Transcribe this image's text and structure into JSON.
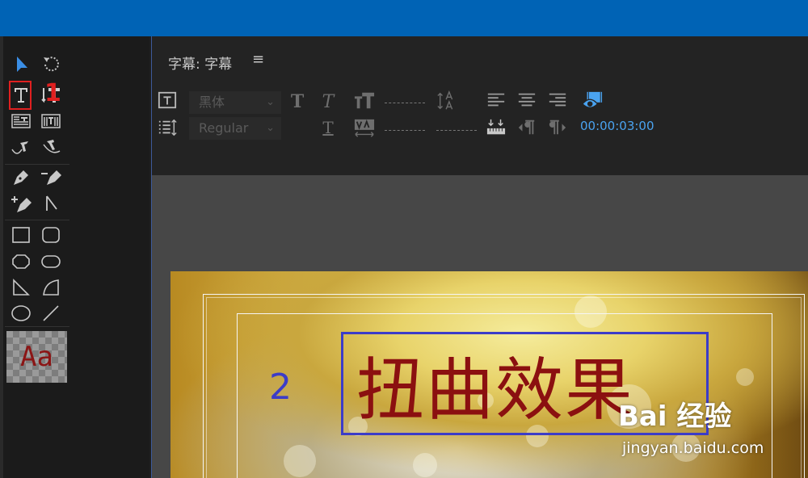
{
  "panel": {
    "title": "字幕: 字幕",
    "menu_icon": "hamburger-icon"
  },
  "toolbar": {
    "font_family": "黑体",
    "font_style": "Regular",
    "timecode": "00:00:03:00"
  },
  "tools": [
    "selection-tool",
    "rotation-tool",
    "type-tool",
    "vertical-type-tool",
    "area-type-tool",
    "vertical-area-type-tool",
    "path-type-tool",
    "vertical-path-type-tool",
    "pen-tool",
    "delete-anchor-tool",
    "add-anchor-tool",
    "convert-anchor-tool",
    "rectangle-tool",
    "rounded-rectangle-tool",
    "clipped-corner-tool",
    "rounded-corner-tool",
    "wedge-tool",
    "arc-tool",
    "ellipse-tool",
    "line-tool"
  ],
  "style_swatch": {
    "label": "Aa",
    "color": "#8b1515"
  },
  "annotations": {
    "step1": "1",
    "step2": "2"
  },
  "canvas": {
    "title_text": "扭曲效果",
    "title_color": "#8b1010",
    "box_color": "#3c3cc8"
  },
  "watermark": {
    "logo_text": "Bai  经验",
    "url": "jingyan.baidu.com"
  },
  "colors": {
    "topbar": "#0063b5",
    "accent_blue": "#4aa3f0",
    "annotation_red": "#e02020"
  }
}
